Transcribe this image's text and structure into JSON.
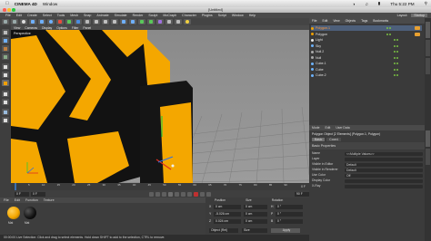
{
  "mac_menu": {
    "apple_icon": "apple-icon",
    "app": "CINEMA 4D",
    "window": "Window",
    "time": "Thu 5:22 PM",
    "status_icons": [
      "wifi-icon",
      "volume-icon",
      "battery-icon",
      "search-icon"
    ]
  },
  "window": {
    "title": "[Untitled]"
  },
  "app_menu": {
    "items": [
      "File",
      "Edit",
      "Create",
      "Select",
      "Tools",
      "Mesh",
      "Snap",
      "Animate",
      "Simulate",
      "Render",
      "Sculpt",
      "MoCraph",
      "Character",
      "Plugins",
      "Script",
      "Window",
      "Help"
    ],
    "layout_label": "Layout:",
    "layout_value": "Startup"
  },
  "viewport": {
    "menu": [
      "View",
      "Cameras",
      "Display",
      "Options",
      "Filter",
      "Panel"
    ],
    "label": "Perspective",
    "colors": {
      "yellow": "#f4a700",
      "black": "#121212",
      "grid": "#8f8f8f"
    }
  },
  "timeline": {
    "ticks": [
      "0",
      "5",
      "10",
      "15",
      "20",
      "25",
      "30",
      "35",
      "40",
      "45",
      "50",
      "55",
      "60",
      "65",
      "70",
      "75",
      "80",
      "85",
      "90"
    ],
    "end_frame": "0 F"
  },
  "transport": {
    "start": "0 F",
    "current": "0 F",
    "end": "90 F",
    "fps": "90 F"
  },
  "material_panel": {
    "menu": [
      "File",
      "Edit",
      "Function",
      "Texture"
    ],
    "material_name": "Mat"
  },
  "coordinates": {
    "headers": [
      "Position",
      "Size",
      "Rotation"
    ],
    "rows": [
      {
        "axis": "X",
        "pos": "0 cm",
        "size": "0 cm",
        "rotaxis": "H",
        "rot": "0 °"
      },
      {
        "axis": "Y",
        "pos": "-5.026 cm",
        "size": "0 cm",
        "rotaxis": "P",
        "rot": "0 °"
      },
      {
        "axis": "Z",
        "pos": "0.024 cm",
        "size": "0 cm",
        "rotaxis": "B",
        "rot": "0 °"
      }
    ],
    "mode": "Object (Rel)",
    "size_mode": "Size",
    "apply": "Apply"
  },
  "status_text": "00:00:00  Live Selection: Click and drag to select elements. Hold down SHIFT to add to the selection, CTRL to remove.",
  "objects_panel": {
    "menu": [
      "File",
      "Edit",
      "View",
      "Objects",
      "Tags",
      "Bookmarks"
    ],
    "rows": [
      {
        "name": "Polygon.1",
        "color": "#f0a000",
        "selected": true
      },
      {
        "name": "Polygon",
        "color": "#f0a000",
        "selected": false
      },
      {
        "name": "Light",
        "color": "#e8e8e8",
        "selected": false
      },
      {
        "name": "Sky",
        "color": "#6db3ff",
        "selected": false
      },
      {
        "name": "Null.2",
        "color": "#aaaaaa",
        "selected": false
      },
      {
        "name": "Null",
        "color": "#aaaaaa",
        "selected": false
      },
      {
        "name": "Cube.1",
        "color": "#6db3ff",
        "selected": false
      },
      {
        "name": "Cube",
        "color": "#6db3ff",
        "selected": false
      },
      {
        "name": "Cube.2",
        "color": "#6db3ff",
        "selected": false
      }
    ]
  },
  "attributes_panel": {
    "menu": [
      "Mode",
      "Edit",
      "User Data"
    ],
    "title": "Polygon Object [2 Elements] (Polygon.1, Polygon)",
    "tabs": [
      "Basic",
      "Coord."
    ],
    "section": "Basic Properties",
    "fields": [
      {
        "label": "Name",
        "value": "<<Multiple Values>>"
      },
      {
        "label": "Layer",
        "value": ""
      },
      {
        "label": "Visible in Editor",
        "value": "Default"
      },
      {
        "label": "Visible in Renderer",
        "value": "Default"
      },
      {
        "label": "Use Color",
        "value": "Off"
      },
      {
        "label": "Display Color",
        "value": ""
      },
      {
        "label": "X-Ray",
        "value": ""
      }
    ]
  },
  "side_tabs": [
    "Objects",
    "Content Browser",
    "Structure",
    "Attributes",
    "Layers"
  ]
}
